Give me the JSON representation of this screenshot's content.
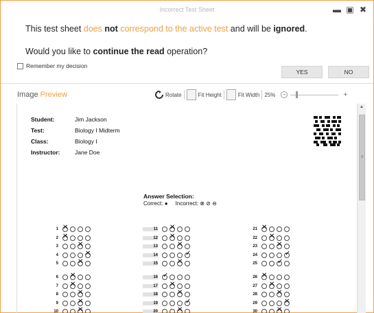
{
  "window": {
    "title": "Incorrect Test Sheet",
    "min_icon": "minimize-icon",
    "max_icon": "maximize-icon",
    "close_icon": "close-icon"
  },
  "message": {
    "line1_a": "This test sheet ",
    "line1_b": "does ",
    "line1_c": "not",
    "line1_d": " correspond to the active test",
    "line1_e": " and will be ",
    "line1_f": "ignored",
    "line1_g": ".",
    "line2_a": "Would you like to ",
    "line2_b": "continue the read",
    "line2_c": " operation?"
  },
  "remember_label": "Remember my decision",
  "buttons": {
    "yes": "YES",
    "no": "NO"
  },
  "preview": {
    "title_a": "Image ",
    "title_b": "Preview",
    "rotate": "Rotate",
    "fit_height": "Fit Height",
    "fit_width": "Fit Width",
    "zoom": "25%"
  },
  "sheet": {
    "student_label": "Student:",
    "student": "Jim Jackson",
    "test_label": "Test:",
    "test": "Biology I Midterm",
    "class_label": "Class:",
    "class": "Biology I",
    "instructor_label": "Instructor:",
    "instructor": "Jane Doe",
    "answer_title": "Answer Selection:",
    "legend_correct": "Correct:",
    "legend_incorrect": "Incorrect:"
  },
  "colors": {
    "accent": "#f0a040",
    "border": "#f0a040"
  },
  "questions": {
    "col1": [
      {
        "n": "1",
        "marks": [
          "x",
          "o",
          "o",
          "o"
        ]
      },
      {
        "n": "2",
        "marks": [
          "x",
          "o",
          "o",
          "o"
        ]
      },
      {
        "n": "3",
        "marks": [
          "o",
          "o",
          "x",
          "o"
        ]
      },
      {
        "n": "4",
        "marks": [
          "o",
          "o",
          "o",
          "x"
        ]
      },
      {
        "n": "5",
        "marks": [
          "o",
          "o",
          "x",
          "o"
        ]
      },
      {
        "n": "6",
        "marks": [
          "o",
          "x",
          "o",
          "o"
        ]
      },
      {
        "n": "7",
        "marks": [
          "o",
          "x",
          "o",
          "o"
        ]
      },
      {
        "n": "8",
        "marks": [
          "o",
          "o",
          "x",
          "o"
        ]
      },
      {
        "n": "9",
        "marks": [
          "o",
          "o",
          "x",
          "o"
        ]
      },
      {
        "n": "10",
        "marks": [
          "o",
          "o",
          "x",
          "o"
        ]
      }
    ],
    "col2": [
      {
        "n": "11",
        "marks": [
          "o",
          "x",
          "o",
          "o"
        ]
      },
      {
        "n": "12",
        "marks": [
          "o",
          "x",
          "o",
          "o"
        ]
      },
      {
        "n": "13",
        "marks": [
          "o",
          "o",
          "x",
          "o"
        ]
      },
      {
        "n": "14",
        "marks": [
          "o",
          "o",
          "o",
          "c"
        ]
      },
      {
        "n": "15",
        "marks": [
          "o",
          "o",
          "x",
          "o"
        ]
      },
      {
        "n": "16",
        "marks": [
          "c",
          "o",
          "o",
          "o"
        ]
      },
      {
        "n": "17",
        "marks": [
          "o",
          "x",
          "o",
          "o"
        ]
      },
      {
        "n": "18",
        "marks": [
          "o",
          "o",
          "x",
          "o"
        ]
      },
      {
        "n": "19",
        "marks": [
          "o",
          "o",
          "o",
          "c"
        ]
      },
      {
        "n": "20",
        "marks": [
          "o",
          "o",
          "x",
          "o"
        ]
      }
    ],
    "col3": [
      {
        "n": "21",
        "marks": [
          "x",
          "o",
          "o",
          "o"
        ]
      },
      {
        "n": "22",
        "marks": [
          "o",
          "x",
          "o",
          "o"
        ]
      },
      {
        "n": "23",
        "marks": [
          "o",
          "o",
          "x",
          "o"
        ]
      },
      {
        "n": "24",
        "marks": [
          "o",
          "o",
          "o",
          "c"
        ]
      },
      {
        "n": "25",
        "marks": [
          "o",
          "o",
          "c",
          "o"
        ]
      },
      {
        "n": "26",
        "marks": [
          "x",
          "o",
          "o",
          "o"
        ]
      },
      {
        "n": "27",
        "marks": [
          "o",
          "x",
          "o",
          "o"
        ]
      },
      {
        "n": "28",
        "marks": [
          "o",
          "o",
          "x",
          "o"
        ]
      },
      {
        "n": "29",
        "marks": [
          "o",
          "o",
          "o",
          "x"
        ]
      },
      {
        "n": "30",
        "marks": [
          "o",
          "o",
          "x",
          "o"
        ]
      }
    ]
  }
}
